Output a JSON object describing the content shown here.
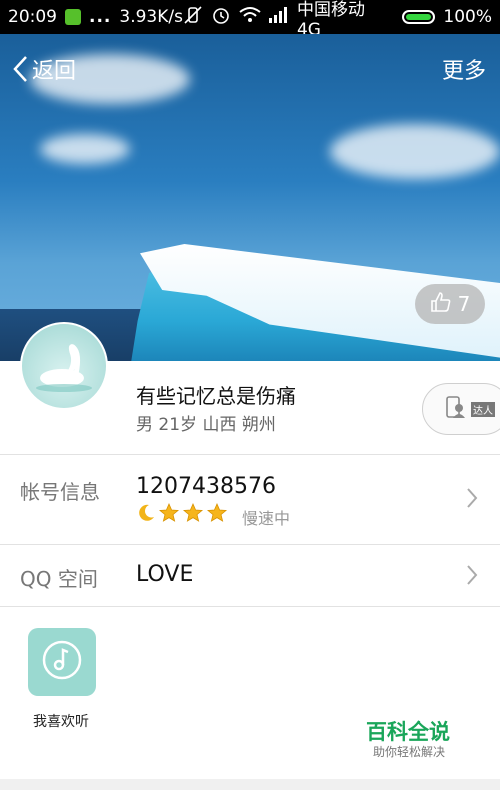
{
  "status_bar": {
    "time": "20:09",
    "dots": "...",
    "speed": "3.93K/s",
    "carrier": "中国移动 4G",
    "battery": "100%"
  },
  "nav": {
    "back_label": "返回",
    "more_label": "更多"
  },
  "likes": {
    "count": "7"
  },
  "profile": {
    "name": "有些记忆总是伤痛",
    "info": "男 21岁 山西 朔州",
    "badge_text": "达人"
  },
  "account": {
    "label": "帐号信息",
    "qq_number": "1207438576",
    "level_status": "慢速中"
  },
  "qzone": {
    "label": "QQ 空间",
    "value": "LOVE"
  },
  "music": {
    "label": "我喜欢听"
  },
  "watermark": {
    "title": "百科全说",
    "subtitle": "助你轻松解决"
  }
}
